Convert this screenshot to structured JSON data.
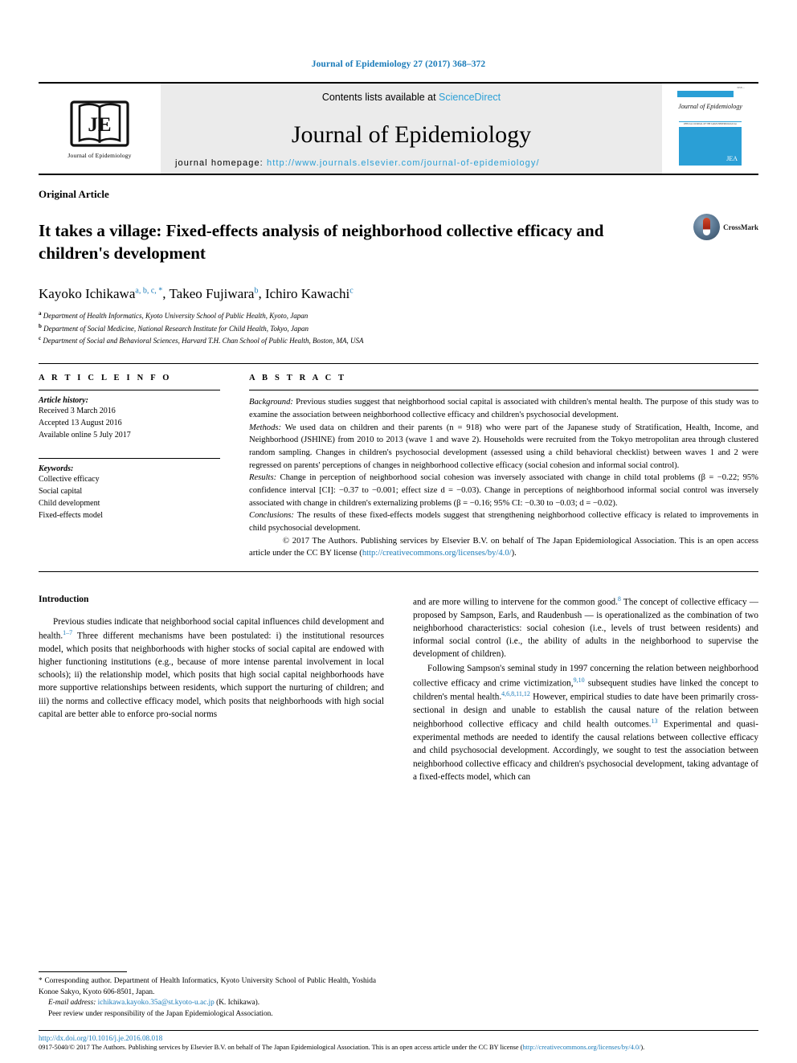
{
  "running_head": "Journal of Epidemiology 27 (2017) 368–372",
  "masthead": {
    "logo_text": "JE",
    "logo_caption": "Journal of Epidemiology",
    "contents_prefix": "Contents lists available at ",
    "contents_link": "ScienceDirect",
    "journal_name": "Journal of Epidemiology",
    "homepage_label": "journal homepage: ",
    "homepage_url": "http://www.journals.elsevier.com/journal-of-epidemiology/",
    "cover": {
      "issn": "ISSN ...",
      "title": "Journal of Epidemiology",
      "strip": "OFFICIAL JOURNAL OF THE JAPAN EPIDEMIOLOGICAL ASSOCIATION",
      "mark": "JEA"
    },
    "accent_color": "#2a9fd6"
  },
  "article": {
    "type_label": "Original Article",
    "title": "It takes a village: Fixed-effects analysis of neighborhood collective efficacy and children's development",
    "crossmark_label": "CrossMark",
    "authors": [
      {
        "name": "Kayoko Ichikawa",
        "marks": "a, b, c, *"
      },
      {
        "name": "Takeo Fujiwara",
        "marks": "b"
      },
      {
        "name": "Ichiro Kawachi",
        "marks": "c"
      }
    ],
    "affiliations": [
      {
        "mark": "a",
        "text": "Department of Health Informatics, Kyoto University School of Public Health, Kyoto, Japan"
      },
      {
        "mark": "b",
        "text": "Department of Social Medicine, National Research Institute for Child Health, Tokyo, Japan"
      },
      {
        "mark": "c",
        "text": "Department of Social and Behavioral Sciences, Harvard T.H. Chan School of Public Health, Boston, MA, USA"
      }
    ]
  },
  "article_info": {
    "heading": "A R T I C L E  I N F O",
    "history_label": "Article history:",
    "history": [
      "Received 3 March 2016",
      "Accepted 13 August 2016",
      "Available online 5 July 2017"
    ],
    "keywords_label": "Keywords:",
    "keywords": [
      "Collective efficacy",
      "Social capital",
      "Child development",
      "Fixed-effects model"
    ]
  },
  "abstract": {
    "heading": "A B S T R A C T",
    "background_label": "Background:",
    "background": " Previous studies suggest that neighborhood social capital is associated with children's mental health. The purpose of this study was to examine the association between neighborhood collective efficacy and children's psychosocial development.",
    "methods_label": "Methods:",
    "methods": " We used data on children and their parents (n = 918) who were part of the Japanese study of Stratification, Health, Income, and Neighborhood (JSHINE) from 2010 to 2013 (wave 1 and wave 2). Households were recruited from the Tokyo metropolitan area through clustered random sampling. Changes in children's psychosocial development (assessed using a child behavioral checklist) between waves 1 and 2 were regressed on parents' perceptions of changes in neighborhood collective efficacy (social cohesion and informal social control).",
    "results_label": "Results:",
    "results": " Change in perception of neighborhood social cohesion was inversely associated with change in child total problems (β = −0.22; 95% confidence interval [CI]: −0.37 to −0.001; effect size d = −0.03). Change in perceptions of neighborhood informal social control was inversely associated with change in children's externalizing problems (β = −0.16; 95% CI: −0.30 to −0.03; d = −0.02).",
    "conclusions_label": "Conclusions:",
    "conclusions": " The results of these fixed-effects models suggest that strengthening neighborhood collective efficacy is related to improvements in child psychosocial development.",
    "copyright": "© 2017 The Authors. Publishing services by Elsevier B.V. on behalf of The Japan Epidemiological Association. This is an open access article under the CC BY license (",
    "copyright_link": "http://creativecommons.org/licenses/by/4.0/",
    "copyright_tail": ")."
  },
  "introduction": {
    "heading": "Introduction",
    "left_p1_a": "Previous studies indicate that neighborhood social capital influences child development and health.",
    "left_p1_ref": "1–7",
    "left_p1_b": " Three different mechanisms have been postulated: i) the institutional resources model, which posits that neighborhoods with higher stocks of social capital are endowed with higher functioning institutions (e.g., because of more intense parental involvement in local schools); ii) the relationship model, which posits that high social capital neighborhoods have more supportive relationships between residents, which support the nurturing of children; and iii) the norms and collective efficacy model, which posits that neighborhoods with high social capital are better able to enforce pro-social norms",
    "right_p1_a": "and are more willing to intervene for the common good.",
    "right_p1_ref": "8",
    "right_p1_b": " The concept of collective efficacy — proposed by Sampson, Earls, and Raudenbush — is operationalized as the combination of two neighborhood characteristics: social cohesion (i.e., levels of trust between residents) and informal social control (i.e., the ability of adults in the neighborhood to supervise the development of children).",
    "right_p2_a": "Following Sampson's seminal study in 1997 concerning the relation between neighborhood collective efficacy and crime victimization,",
    "right_p2_ref1": "9,10",
    "right_p2_b": " subsequent studies have linked the concept to children's mental health.",
    "right_p2_ref2": "4,6,8,11,12",
    "right_p2_c": " However, empirical studies to date have been primarily cross-sectional in design and unable to establish the causal nature of the relation between neighborhood collective efficacy and child health outcomes.",
    "right_p2_ref3": "13",
    "right_p2_d": " Experimental and quasi-experimental methods are needed to identify the causal relations between collective efficacy and child psychosocial development. Accordingly, we sought to test the association between neighborhood collective efficacy and children's psychosocial development, taking advantage of a fixed-effects model, which can"
  },
  "footnote": {
    "corresponding": "* Corresponding author. Department of Health Informatics, Kyoto University School of Public Health, Yoshida Konoe Sakyo, Kyoto 606-8501, Japan.",
    "email_label": "E-mail address:",
    "email": "ichikawa.kayoko.35a@st.kyoto-u.ac.jp",
    "email_suffix": " (K. Ichikawa).",
    "peer_review": "Peer review under responsibility of the Japan Epidemiological Association."
  },
  "page_footer": {
    "doi": "http://dx.doi.org/10.1016/j.je.2016.08.018",
    "copy_prefix": "0917-5040/© 2017 The Authors. Publishing services by Elsevier B.V. on behalf of The Japan Epidemiological Association. This is an open access article under the CC BY license",
    "copy_link": "http://creativecommons.org/licenses/by/4.0/",
    "copy_tail": ")."
  }
}
